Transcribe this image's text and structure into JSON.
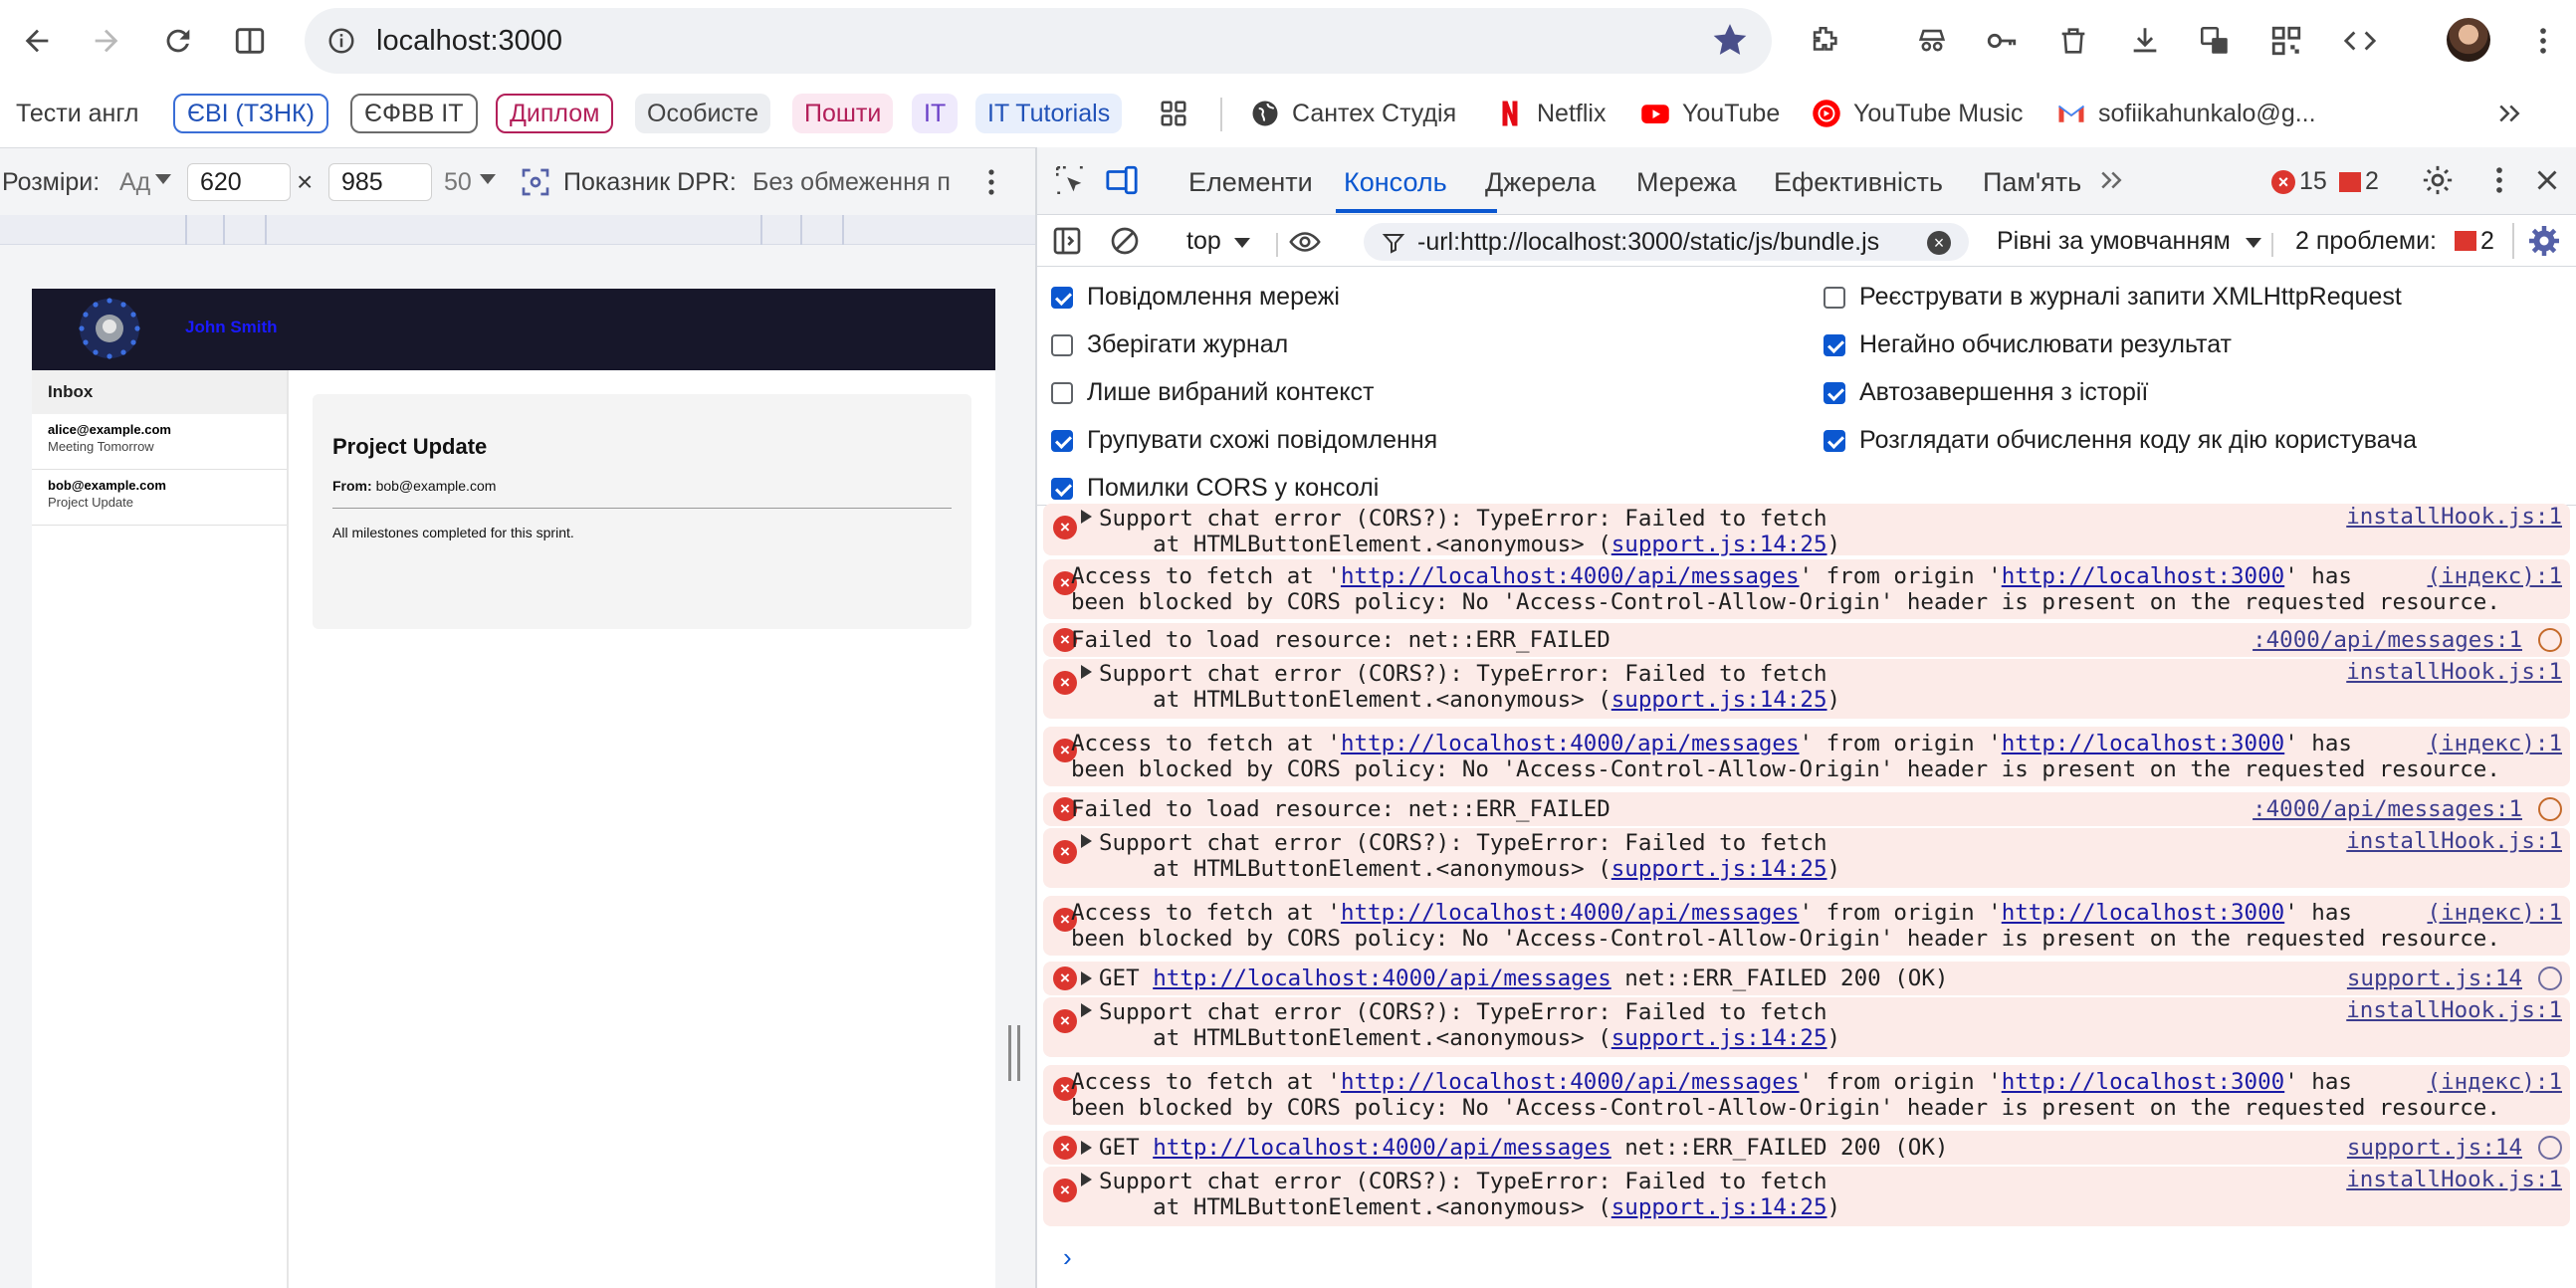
{
  "browser": {
    "url": "localhost:3000"
  },
  "bookmarks": [
    {
      "label": "Тести англ"
    },
    {
      "label": "ЄВІ (ТЗНК)"
    },
    {
      "label": "ЄФВВ ІТ"
    },
    {
      "label": "Диплом"
    },
    {
      "label": "Особисте"
    },
    {
      "label": "Пошти"
    },
    {
      "label": "ІТ"
    },
    {
      "label": "IT Tutorials"
    },
    {
      "label": "Сантех Студія"
    },
    {
      "label": "Netflix"
    },
    {
      "label": "YouTube"
    },
    {
      "label": "YouTube Music"
    },
    {
      "label": "sofiikahunkalo@g..."
    }
  ],
  "device_toolbar": {
    "dims_label": "Розміри:",
    "device_value": "Ад",
    "width": "620",
    "times": "×",
    "height": "985",
    "zoom": "50",
    "dpr_label": "Показник DPR:",
    "throttle": "Без обмеження п"
  },
  "app": {
    "name": "John Smith",
    "inbox_title": "Inbox",
    "emails": [
      {
        "from": "alice@example.com",
        "subject": "Meeting Tomorrow"
      },
      {
        "from": "bob@example.com",
        "subject": "Project Update"
      }
    ],
    "open_email": {
      "title": "Project Update",
      "from_label": "From:",
      "from_value": "bob@example.com",
      "body": "All milestones completed for this sprint."
    }
  },
  "devtools": {
    "tabs": [
      "Елементи",
      "Консоль",
      "Джерела",
      "Мережа",
      "Ефективність",
      "Пам'ять"
    ],
    "active_tab": "Консоль",
    "error_count": "15",
    "issue_count": "2",
    "context": "top",
    "filter": "-url:http://localhost:3000/static/js/bundle.js",
    "levels": "Рівні за умовчанням",
    "problems_label": "2 проблеми:",
    "problems_count": "2",
    "settings": [
      {
        "label": "Повідомлення мережі",
        "checked": true
      },
      {
        "label": "Зберігати журнал",
        "checked": false
      },
      {
        "label": "Лише вибраний контекст",
        "checked": false
      },
      {
        "label": "Групувати схожі повідомлення",
        "checked": true
      },
      {
        "label": "Помилки CORS у консолі",
        "checked": true
      },
      {
        "label": "Реєструвати в журналі запити XMLHttpRequest",
        "checked": false
      },
      {
        "label": "Негайно обчислювати результат",
        "checked": true
      },
      {
        "label": "Автозавершення з історії",
        "checked": true
      },
      {
        "label": "Розглядати обчислення коду як дію користувача",
        "checked": true
      }
    ],
    "text": {
      "chat_error": "Support chat error (CORS?): TypeError: Failed to fetch",
      "at_prefix": "    at HTMLButtonElement.<anonymous> (",
      "at_link": "support.js:14:25",
      "at_suffix": ")",
      "access_prefix": "Access to fetch at '",
      "api_url": "http://localhost:4000/api/messages",
      "from_origin": "' from origin '",
      "origin_url": "http://localhost:3000",
      "has": "' has",
      "blocked": "been blocked by CORS policy: No 'Access-Control-Allow-Origin' header is present on the requested resource.",
      "failed_load": "Failed to load resource: net::ERR_FAILED",
      "get_prefix": "GET ",
      "get_suffix": " net::ERR_FAILED 200 (OK)",
      "src_install": "installHook.js:1",
      "src_index": "(індекс):1",
      "src_api": ":4000/api/messages:1",
      "src_support": "support.js:14"
    },
    "prompt": "›"
  }
}
